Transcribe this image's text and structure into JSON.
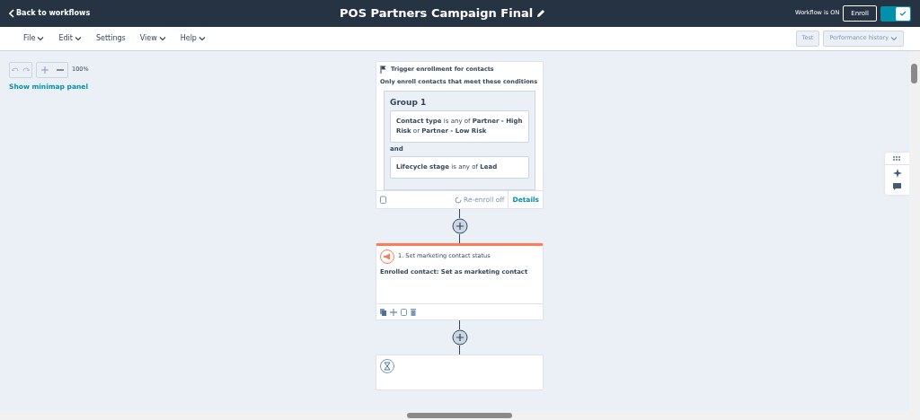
{
  "header": {
    "back_link": "Back to workflows",
    "title": "POS Partners Campaign Final",
    "status": "Workflow is ON",
    "enroll_button": "Enroll",
    "toggle": {
      "on": true
    }
  },
  "menu": [
    {
      "label": "File",
      "dropdown": true
    },
    {
      "label": "Edit",
      "dropdown": true
    },
    {
      "label": "Settings",
      "dropdown": false
    },
    {
      "label": "View",
      "dropdown": true
    },
    {
      "label": "Help",
      "dropdown": true
    }
  ],
  "toolbar_right": {
    "test_button": "Test",
    "history_button": "Performance history"
  },
  "canvas_controls": {
    "zoom": "100%",
    "minimap_link": "Show minimap panel"
  },
  "trigger": {
    "title": "Trigger enrollment for contacts",
    "subtitle": "Only enroll contacts that meet these conditions",
    "group": "Group 1",
    "conditions": [
      "**Contact type** is any of **Partner - High Risk** or **Partner - Low Risk**",
      "**Lifecycle stage** is any of **Lead**"
    ],
    "joiner": "and",
    "reenroll": "Re-enroll off",
    "details": "Details"
  },
  "action": {
    "title": "1. Set marketing contact status",
    "body": "Enrolled contact: Set as marketing contact"
  }
}
